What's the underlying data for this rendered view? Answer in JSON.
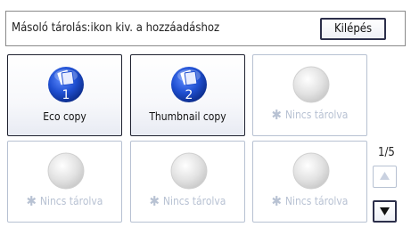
{
  "header": {
    "title": "Másoló tárolás:ikon kiv. a hozzáadáshoz",
    "exit_label": "Kilépés"
  },
  "programs": [
    {
      "label": "Eco copy",
      "number": "1",
      "stored": true
    },
    {
      "label": "Thumbnail copy",
      "number": "2",
      "stored": true
    },
    {
      "label": "Nincs tárolva",
      "stored": false
    },
    {
      "label": "Nincs tárolva",
      "stored": false
    },
    {
      "label": "Nincs tárolva",
      "stored": false
    },
    {
      "label": "Nincs tárolva",
      "stored": false
    }
  ],
  "pager": {
    "page_indicator": "1/5"
  },
  "icons": {
    "stored": "program-disc-icon",
    "empty": "empty-slot-disc-icon",
    "not_stored_marker": "asterisk-icon",
    "scroll_up": "up-arrow-icon",
    "scroll_down": "down-arrow-icon"
  },
  "colors": {
    "stored_disc": "#1f4fd1",
    "empty_disc": "#dcdcdc",
    "empty_text": "#b8c2d3",
    "frame_dark": "#2c2f4a"
  }
}
